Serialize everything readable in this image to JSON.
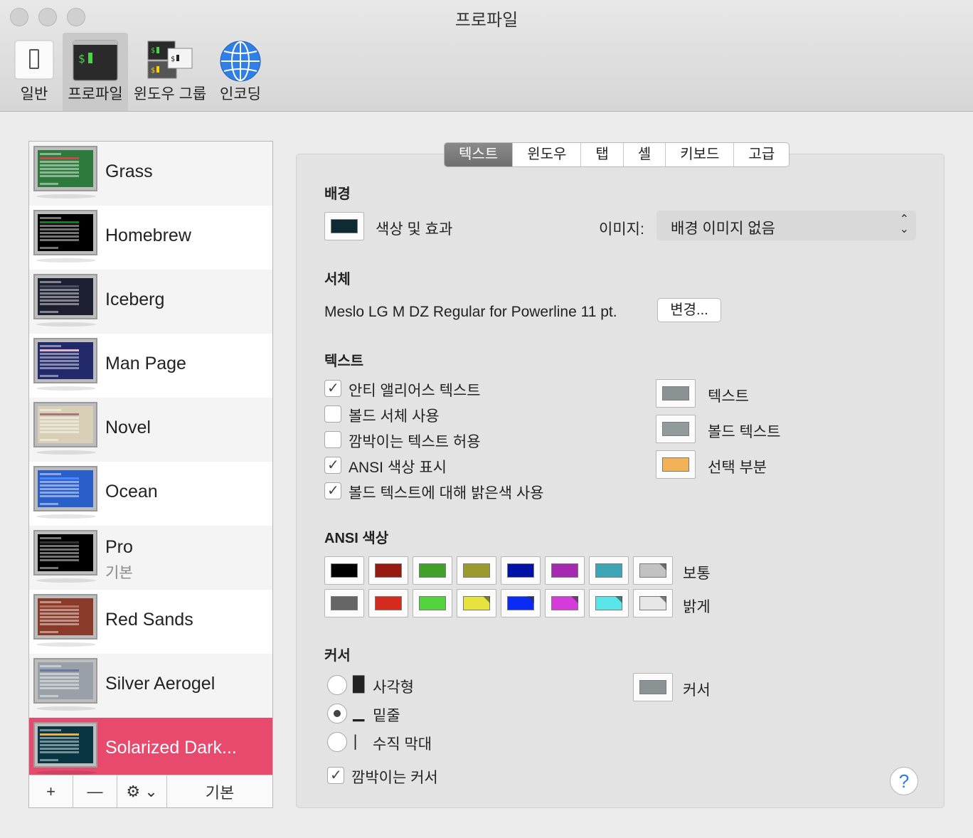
{
  "window": {
    "title": "프로파일"
  },
  "toolbar": {
    "items": [
      {
        "label": "일반",
        "icon": "switch-icon"
      },
      {
        "label": "프로파일",
        "icon": "terminal-icon"
      },
      {
        "label": "윈도우 그룹",
        "icon": "window-group-icon"
      },
      {
        "label": "인코딩",
        "icon": "globe-icon"
      }
    ],
    "active": "프로파일"
  },
  "profiles": [
    {
      "name": "Grass",
      "bg": "#2d7a3c",
      "hl": "#c8484b"
    },
    {
      "name": "Homebrew",
      "bg": "#000000",
      "hl": "#1c7a1c"
    },
    {
      "name": "Iceberg",
      "bg": "#1d2030",
      "hl": "#4a4e66"
    },
    {
      "name": "Man Page",
      "bg": "#232a6b",
      "hl": "#e7b6c4"
    },
    {
      "name": "Novel",
      "bg": "#d8cfb6",
      "hl": "#a3787b"
    },
    {
      "name": "Ocean",
      "bg": "#2a5fc9",
      "hl": "#4b86ff"
    },
    {
      "name": "Pro",
      "sub": "기본",
      "bg": "#000000",
      "hl": "#333333"
    },
    {
      "name": "Red Sands",
      "bg": "#8a3a28",
      "hl": "#b87060"
    },
    {
      "name": "Silver Aerogel",
      "bg": "#9aa0a8",
      "hl": "#6878a0"
    },
    {
      "name": "Solarized Dark...",
      "bg": "#073642",
      "hl": "#e9b04f",
      "selected": true
    }
  ],
  "sidebar_buttons": {
    "add": "+",
    "remove": "—",
    "gear": "⚙ ⌄",
    "default": "기본"
  },
  "tabs": [
    "텍스트",
    "윈도우",
    "탭",
    "셸",
    "키보드",
    "고급"
  ],
  "active_tab": "텍스트",
  "background": {
    "heading": "배경",
    "color_label": "색상 및 효과",
    "color": "#0e2a33",
    "image_label": "이미지:",
    "image_value": "배경 이미지 없음"
  },
  "font": {
    "heading": "서체",
    "value": "Meslo LG M DZ Regular for Powerline 11 pt.",
    "change_button": "변경..."
  },
  "text": {
    "heading": "텍스트",
    "checkboxes": [
      {
        "label": "안티 앨리어스 텍스트",
        "checked": true
      },
      {
        "label": "볼드 서체 사용",
        "checked": false
      },
      {
        "label": "깜박이는 텍스트 허용",
        "checked": false
      },
      {
        "label": "ANSI 색상 표시",
        "checked": true
      },
      {
        "label": "볼드 텍스트에 대해 밝은색 사용",
        "checked": true
      }
    ],
    "colors": [
      {
        "label": "텍스트",
        "color": "#8a9293"
      },
      {
        "label": "볼드 텍스트",
        "color": "#929a9b"
      },
      {
        "label": "선택 부분",
        "color": "#f1b355"
      }
    ]
  },
  "ansi": {
    "heading": "ANSI 색상",
    "normal_label": "보통",
    "bright_label": "밝게",
    "normal": [
      "#000000",
      "#971a12",
      "#3fa12a",
      "#9b9a2f",
      "#0012a6",
      "#a52ab0",
      "#3ea6b5",
      "#c2c2c2"
    ],
    "bright": [
      "#666666",
      "#d42b1e",
      "#54d23b",
      "#e6e33d",
      "#0a2bf5",
      "#d43bd9",
      "#5ae5e8",
      "#e6e6e6"
    ]
  },
  "cursor": {
    "heading": "커서",
    "options": [
      {
        "glyph": "█",
        "label": "사각형",
        "selected": false
      },
      {
        "glyph": "▁",
        "label": "밑줄",
        "selected": true
      },
      {
        "glyph": "|",
        "label": "수직 막대",
        "selected": false
      }
    ],
    "color_label": "커서",
    "color": "#8a9293",
    "blink_label": "깜박이는 커서",
    "blink": true
  },
  "help": "?"
}
